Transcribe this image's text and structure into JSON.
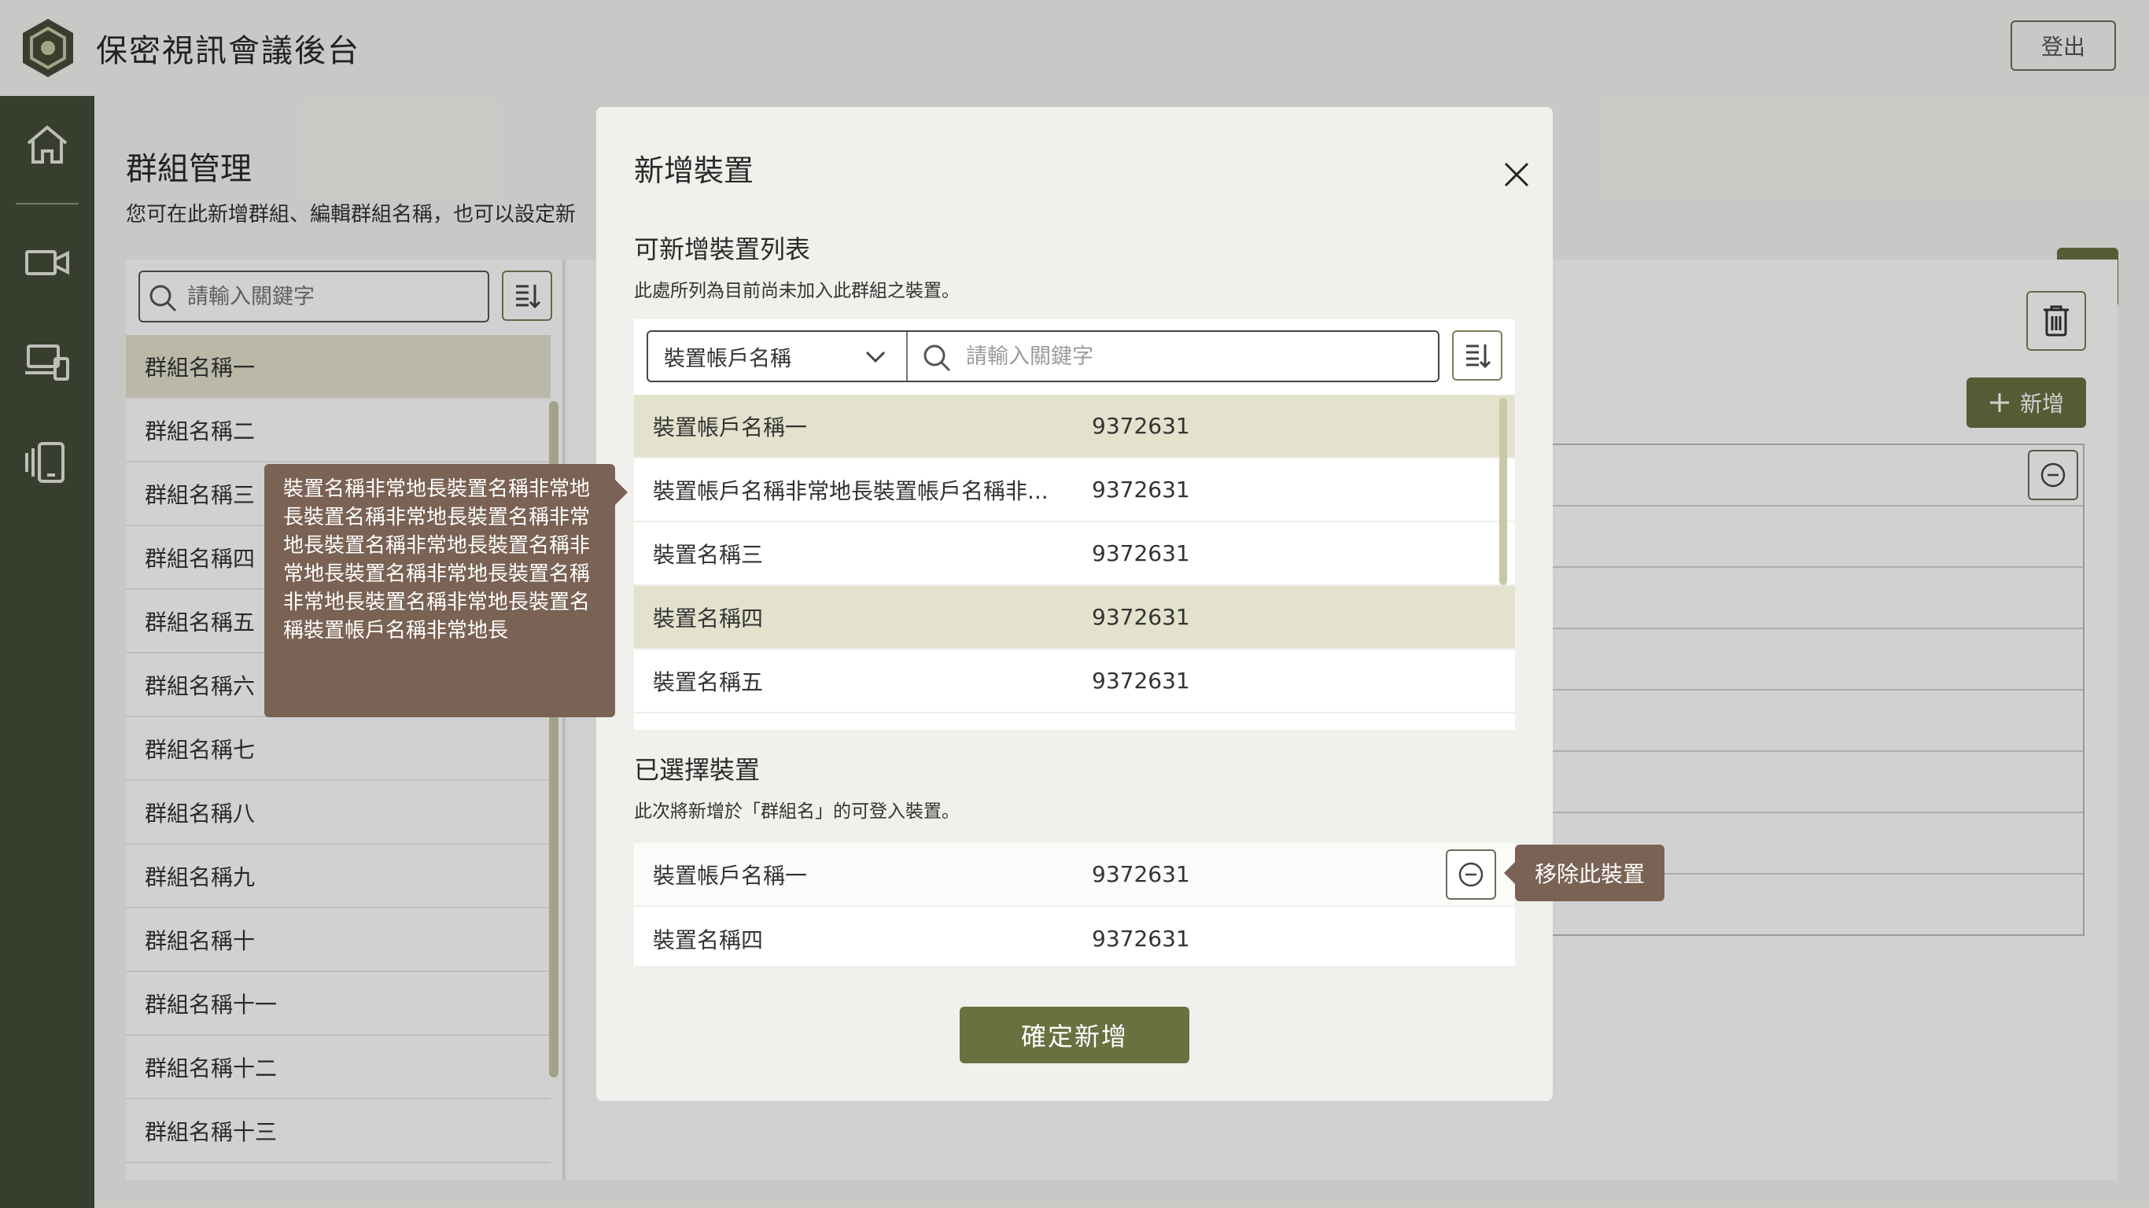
{
  "app": {
    "title": "保密視訊會議後台",
    "logout_label": "登出"
  },
  "sidenav": {
    "items": [
      "home-icon",
      "video-camera-icon",
      "devices-icon",
      "tablet-icon"
    ]
  },
  "page": {
    "title": "群組管理",
    "description": "您可在此新增群組、編輯群組名稱，也可以設定新"
  },
  "groups": {
    "search_placeholder": "請輸入關鍵字",
    "items": [
      "群組名稱一",
      "群組名稱二",
      "群組名稱三",
      "群組名稱四",
      "群組名稱五",
      "群組名稱六",
      "群組名稱七",
      "群組名稱八",
      "群組名稱九",
      "群組名稱十",
      "群組名稱十一",
      "群組名稱十二",
      "群組名稱十三"
    ],
    "selected_index": 0
  },
  "right_panel": {
    "add_label": "新增"
  },
  "modal": {
    "title": "新增裝置",
    "available": {
      "title": "可新增裝置列表",
      "description": "此處所列為目前尚未加入此群組之裝置。",
      "filter_select": "裝置帳戶名稱",
      "search_placeholder": "請輸入關鍵字",
      "rows": [
        {
          "name": "裝置帳戶名稱一",
          "id": "9372631",
          "highlight": true
        },
        {
          "name": "裝置帳戶名稱非常地長裝置帳戶名稱非...",
          "id": "9372631",
          "highlight": false
        },
        {
          "name": "裝置名稱三",
          "id": "9372631",
          "highlight": false
        },
        {
          "name": "裝置名稱四",
          "id": "9372631",
          "highlight": true
        },
        {
          "name": "裝置名稱五",
          "id": "9372631",
          "highlight": false
        }
      ]
    },
    "selected": {
      "title": "已選擇裝置",
      "description": "此次將新增於「群組名」的可登入裝置。",
      "rows": [
        {
          "name": "裝置帳戶名稱一",
          "id": "9372631"
        },
        {
          "name": "裝置名稱四",
          "id": "9372631"
        }
      ]
    },
    "confirm_label": "確定新增"
  },
  "tooltips": {
    "long_name": "裝置名稱非常地長裝置名稱非常地長裝置名稱非常地長裝置名稱非常地長裝置名稱非常地長裝置名稱非常地長裝置名稱非常地長裝置名稱非常地長裝置名稱非常地長裝置名稱裝置帳戶名稱非常地長",
    "remove": "移除此裝置"
  },
  "colors": {
    "primary": "#6b7041",
    "sidebar": "#454c39",
    "highlight": "#e3e2cd",
    "tooltip": "#7a6254"
  }
}
